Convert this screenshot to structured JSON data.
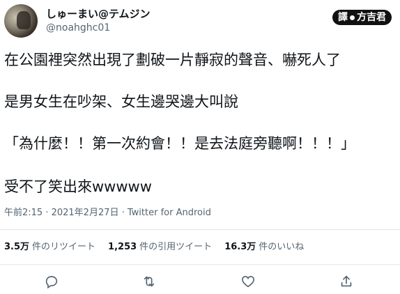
{
  "tweet": {
    "display_name": "しゅーまい@テムジン",
    "handle": "@noahghc01",
    "credit_label_left": "譯",
    "credit_label_right": "方吉君",
    "lines": [
      "在公園裡突然出現了劃破一片靜寂的聲音、嚇死人了",
      "是男女生在吵架、女生邊哭邊大叫說",
      "「為什麼！！第一次約會！！是去法庭旁聽啊！！！」",
      "受不了笑出來wwwww"
    ],
    "meta": "午前2:15 · 2021年2月27日 · Twitter for Android"
  },
  "stats": [
    {
      "value": "3.5万",
      "label": "件のリツイート"
    },
    {
      "value": "1,253",
      "label": "件の引用ツイート"
    },
    {
      "value": "16.3万",
      "label": "件のいいね"
    }
  ],
  "actions": {
    "reply_icon": "reply-icon",
    "retweet_icon": "retweet-icon",
    "like_icon": "heart-icon",
    "share_icon": "share-icon"
  },
  "colors": {
    "text_primary": "#0f1419",
    "text_secondary": "#536471",
    "divider": "#e1e8ed"
  }
}
